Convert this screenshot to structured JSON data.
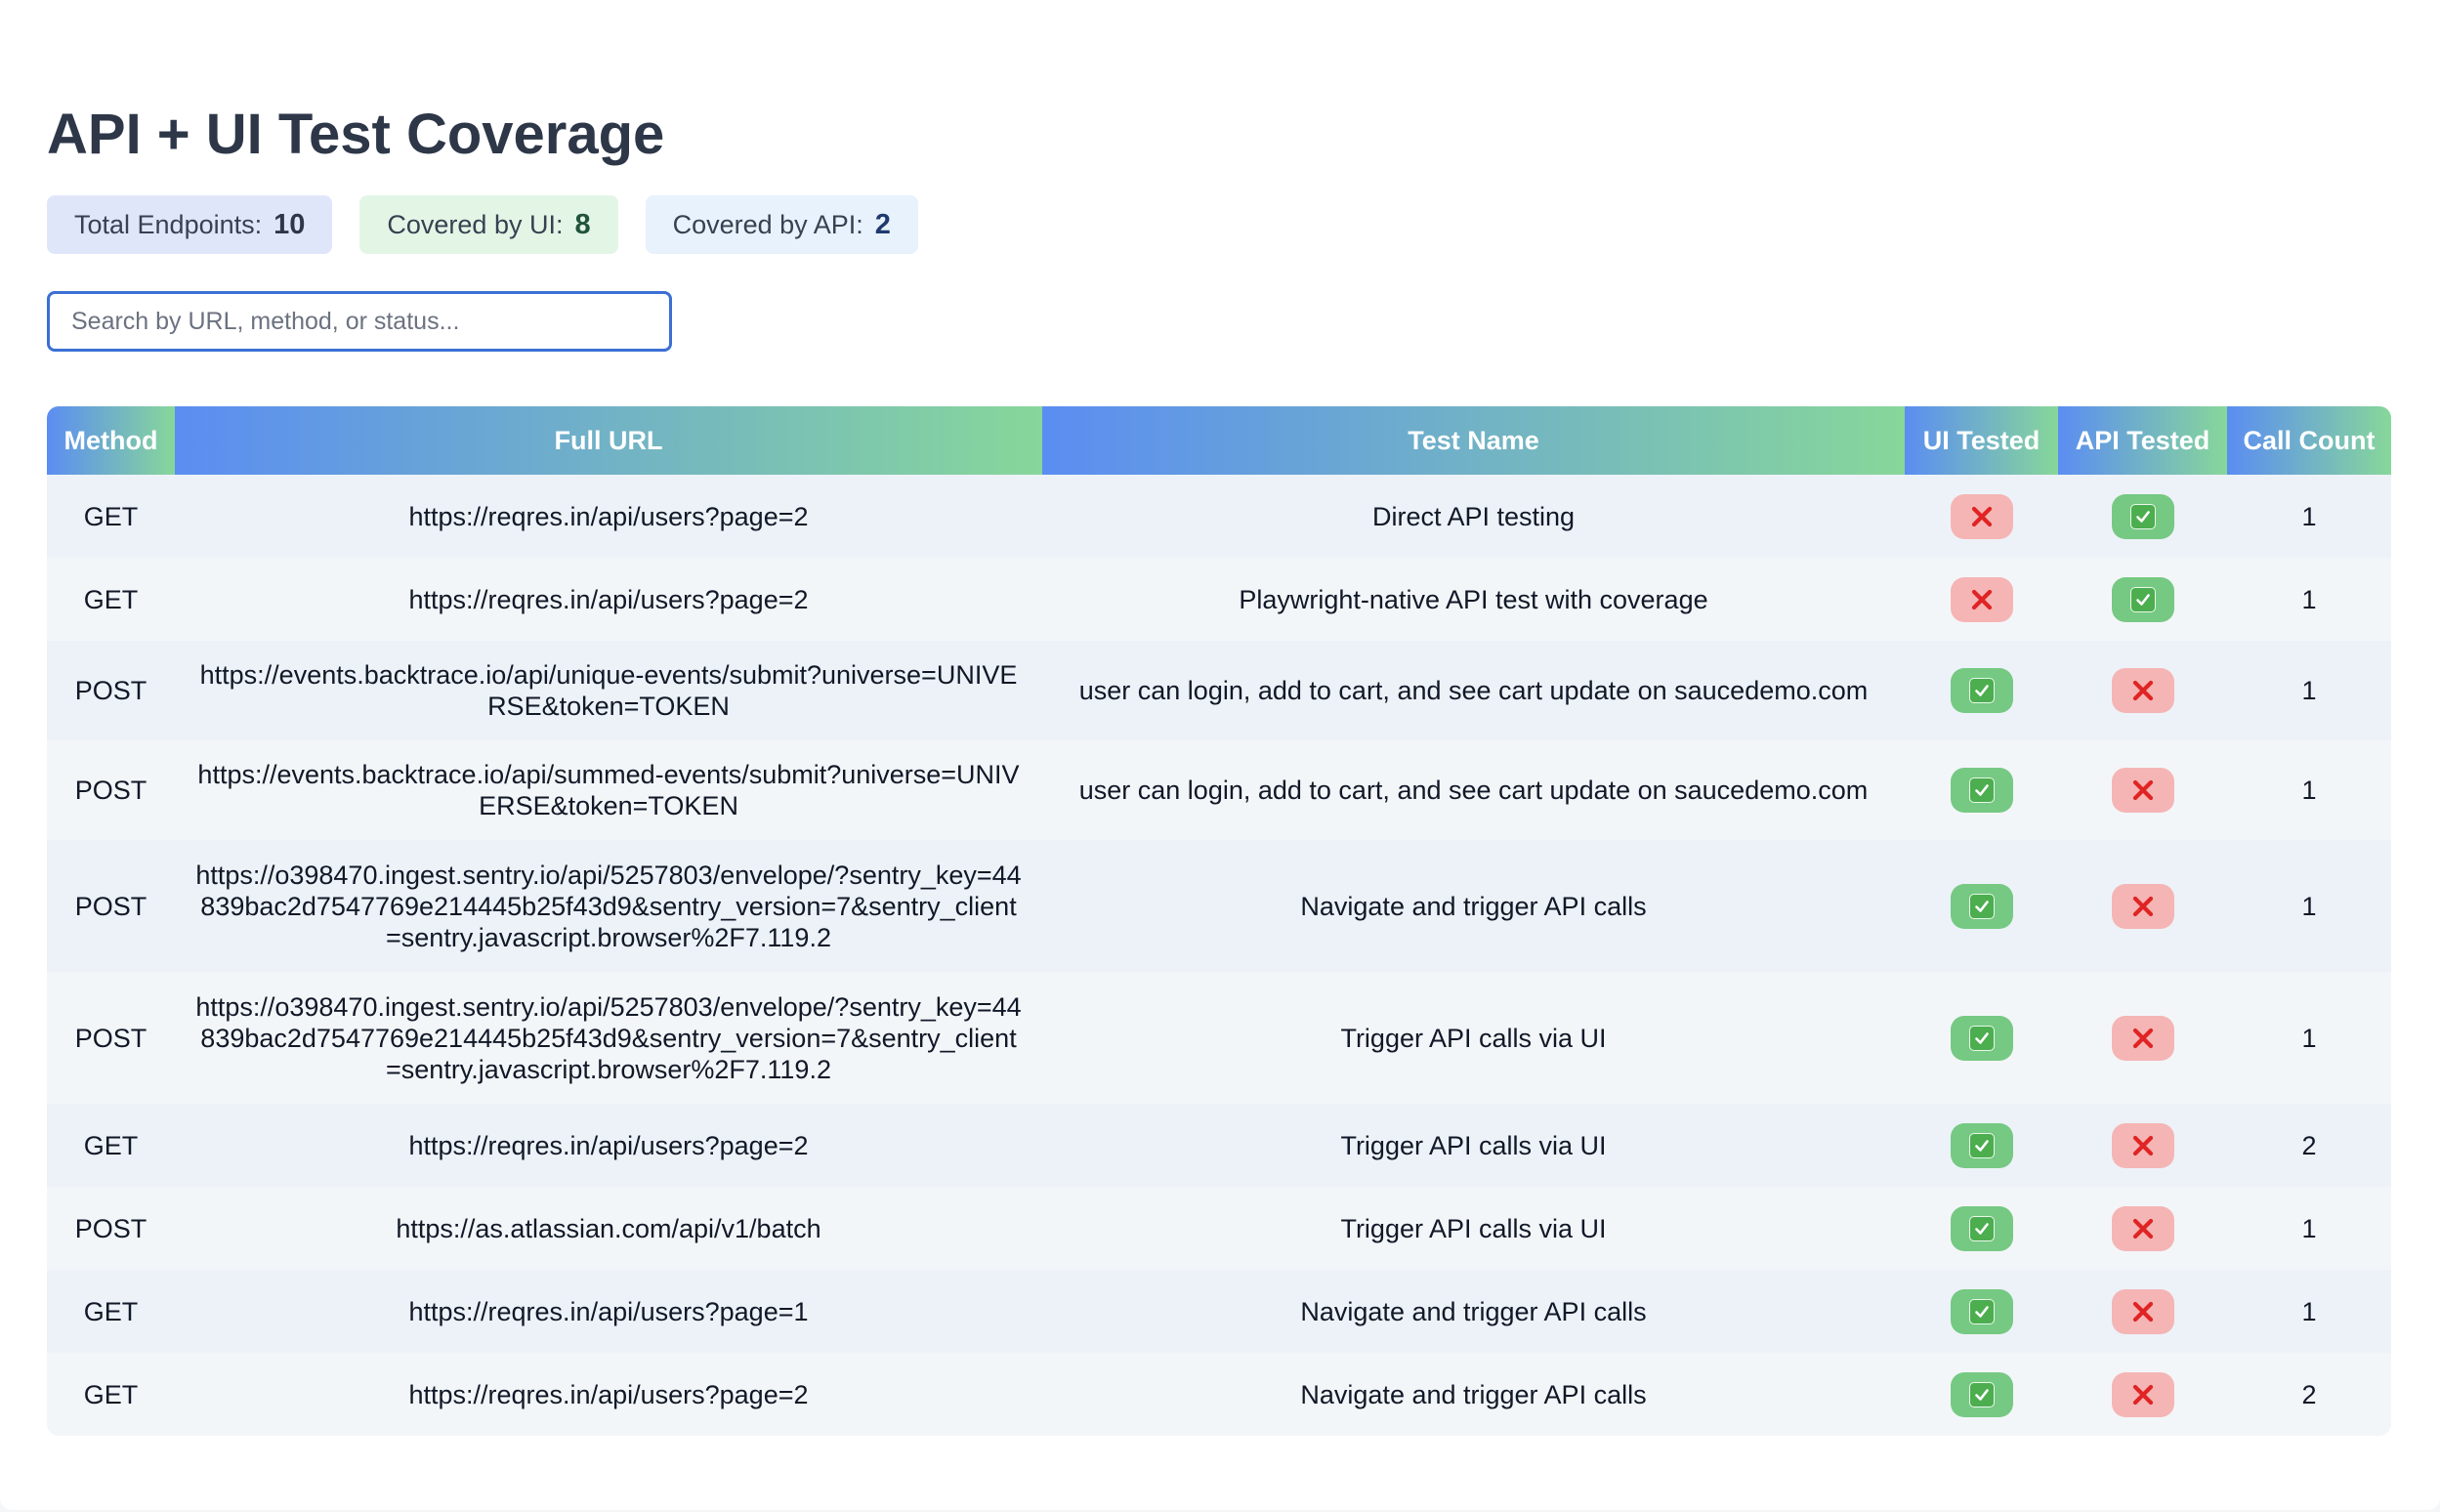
{
  "page": {
    "title": "API + UI Test Coverage"
  },
  "stats": {
    "total_label": "Total Endpoints:",
    "total_value": "10",
    "ui_label": "Covered by UI:",
    "ui_value": "8",
    "api_label": "Covered by API:",
    "api_value": "2"
  },
  "search": {
    "placeholder": "Search by URL, method, or status...",
    "value": ""
  },
  "table": {
    "headers": [
      "Method",
      "Full URL",
      "Test Name",
      "UI Tested",
      "API Tested",
      "Call Count"
    ],
    "rows": [
      {
        "method": "GET",
        "url": "https://reqres.in/api/users?page=2",
        "test_name": "Direct API testing",
        "ui_tested": false,
        "api_tested": true,
        "call_count": "1"
      },
      {
        "method": "GET",
        "url": "https://reqres.in/api/users?page=2",
        "test_name": "Playwright-native API test with coverage",
        "ui_tested": false,
        "api_tested": true,
        "call_count": "1"
      },
      {
        "method": "POST",
        "url": "https://events.backtrace.io/api/unique-events/submit?universe=UNIVERSE&token=TOKEN",
        "test_name": "user can login, add to cart, and see cart update on saucedemo.com",
        "ui_tested": true,
        "api_tested": false,
        "call_count": "1"
      },
      {
        "method": "POST",
        "url": "https://events.backtrace.io/api/summed-events/submit?universe=UNIVERSE&token=TOKEN",
        "test_name": "user can login, add to cart, and see cart update on saucedemo.com",
        "ui_tested": true,
        "api_tested": false,
        "call_count": "1"
      },
      {
        "method": "POST",
        "url": "https://o398470.ingest.sentry.io/api/5257803/envelope/?sentry_key=44839bac2d7547769e214445b25f43d9&sentry_version=7&sentry_client=sentry.javascript.browser%2F7.119.2",
        "test_name": "Navigate and trigger API calls",
        "ui_tested": true,
        "api_tested": false,
        "call_count": "1"
      },
      {
        "method": "POST",
        "url": "https://o398470.ingest.sentry.io/api/5257803/envelope/?sentry_key=44839bac2d7547769e214445b25f43d9&sentry_version=7&sentry_client=sentry.javascript.browser%2F7.119.2",
        "test_name": "Trigger API calls via UI",
        "ui_tested": true,
        "api_tested": false,
        "call_count": "1"
      },
      {
        "method": "GET",
        "url": "https://reqres.in/api/users?page=2",
        "test_name": "Trigger API calls via UI",
        "ui_tested": true,
        "api_tested": false,
        "call_count": "2"
      },
      {
        "method": "POST",
        "url": "https://as.atlassian.com/api/v1/batch",
        "test_name": "Trigger API calls via UI",
        "ui_tested": true,
        "api_tested": false,
        "call_count": "1"
      },
      {
        "method": "GET",
        "url": "https://reqres.in/api/users?page=1",
        "test_name": "Navigate and trigger API calls",
        "ui_tested": true,
        "api_tested": false,
        "call_count": "1"
      },
      {
        "method": "GET",
        "url": "https://reqres.in/api/users?page=2",
        "test_name": "Navigate and trigger API calls",
        "ui_tested": true,
        "api_tested": false,
        "call_count": "2"
      }
    ]
  },
  "icons": {
    "tested_yes": "check-mark-icon",
    "tested_no": "cross-mark-icon"
  },
  "colors": {
    "header_gradient_start": "#5b8df2",
    "header_gradient_end": "#87d79a",
    "badge_yes": "#76c983",
    "badge_no": "#f5b5b5",
    "cross": "#e02424",
    "search_border": "#3b6fd4"
  }
}
